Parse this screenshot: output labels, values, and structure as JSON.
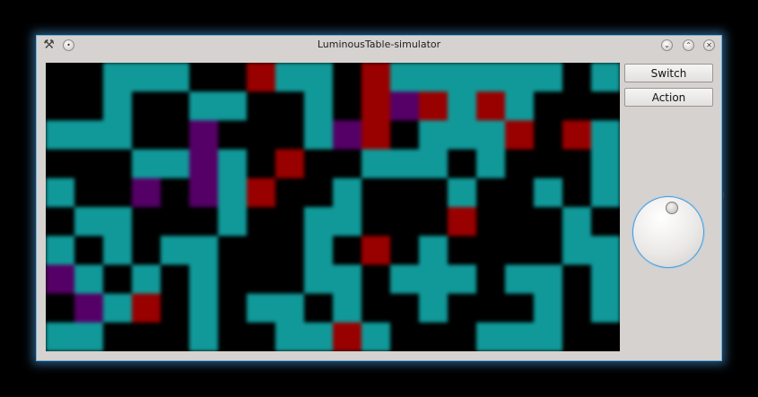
{
  "window": {
    "title": "LuminousTable-simulator",
    "app_icon": "tools-icon",
    "accent": "#6fb3e0"
  },
  "titlebar": {
    "menu_icon": "circle-menu-icon",
    "minimize_icon": "chevron-down-icon",
    "maximize_icon": "chevron-up-icon",
    "close_icon": "close-icon"
  },
  "controls": {
    "switch_label": "Switch",
    "action_label": "Action",
    "dial_icon": "dial-knob"
  },
  "grid": {
    "rows": 10,
    "cols": 20,
    "colors": {
      "K": "#000000",
      "C": "#119999",
      "R": "#990000",
      "P": "#550066"
    },
    "cells": [
      "KKCCCKKRCCKRCCCCCCKC",
      "KKCKKCCKKCKRPRCRCKKK",
      "CCCKKPKKKCPRKCCCRKRC",
      "KKKCCPCKRKKCCCKCKKKC",
      "CKKPKPCRKKCKKKCKKCKC",
      "KCCKKKCKKCCKKKRKKKCK",
      "CKCKCCKKKCKRKCKKKKCC",
      "PCKCKCKKKCCKCCCKCCKC",
      "KPCRKCKCCKCKKCKKKCKC",
      "CCKKKCKKCCRCKKKCCCKK"
    ]
  }
}
